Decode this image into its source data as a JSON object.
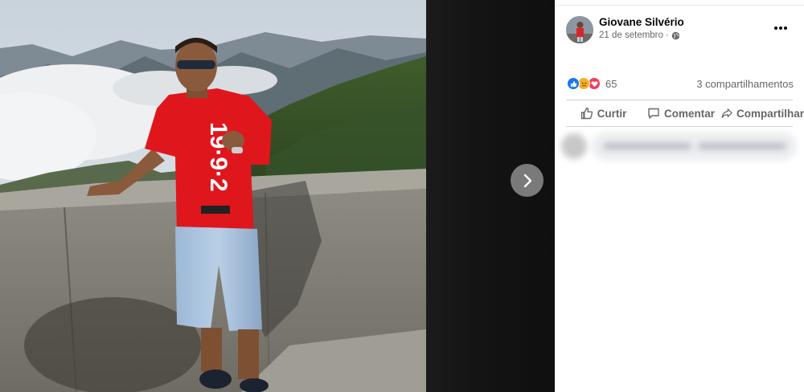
{
  "viewer": {
    "next_icon": "chevron-right-icon",
    "photo_subject": "man-at-mountain-viewpoint",
    "shirt_text": "19·9·2"
  },
  "post": {
    "author": "Giovane Silvério",
    "date": "21 de setembro",
    "separator": "·",
    "privacy_icon": "globe-icon",
    "more_icon": "more-dots-icon"
  },
  "reactions": {
    "types": [
      "like",
      "sad",
      "love"
    ],
    "count": "65",
    "shares": "3 compartilhamentos"
  },
  "actions": {
    "like": "Curtir",
    "comment": "Comentar",
    "share": "Compartilhar"
  },
  "colors": {
    "like_blue": "#1877f2",
    "sad_yellow": "#f7b125",
    "love_red": "#f33e58",
    "meta_gray": "#65676b",
    "shirt_red": "#e0161d"
  }
}
